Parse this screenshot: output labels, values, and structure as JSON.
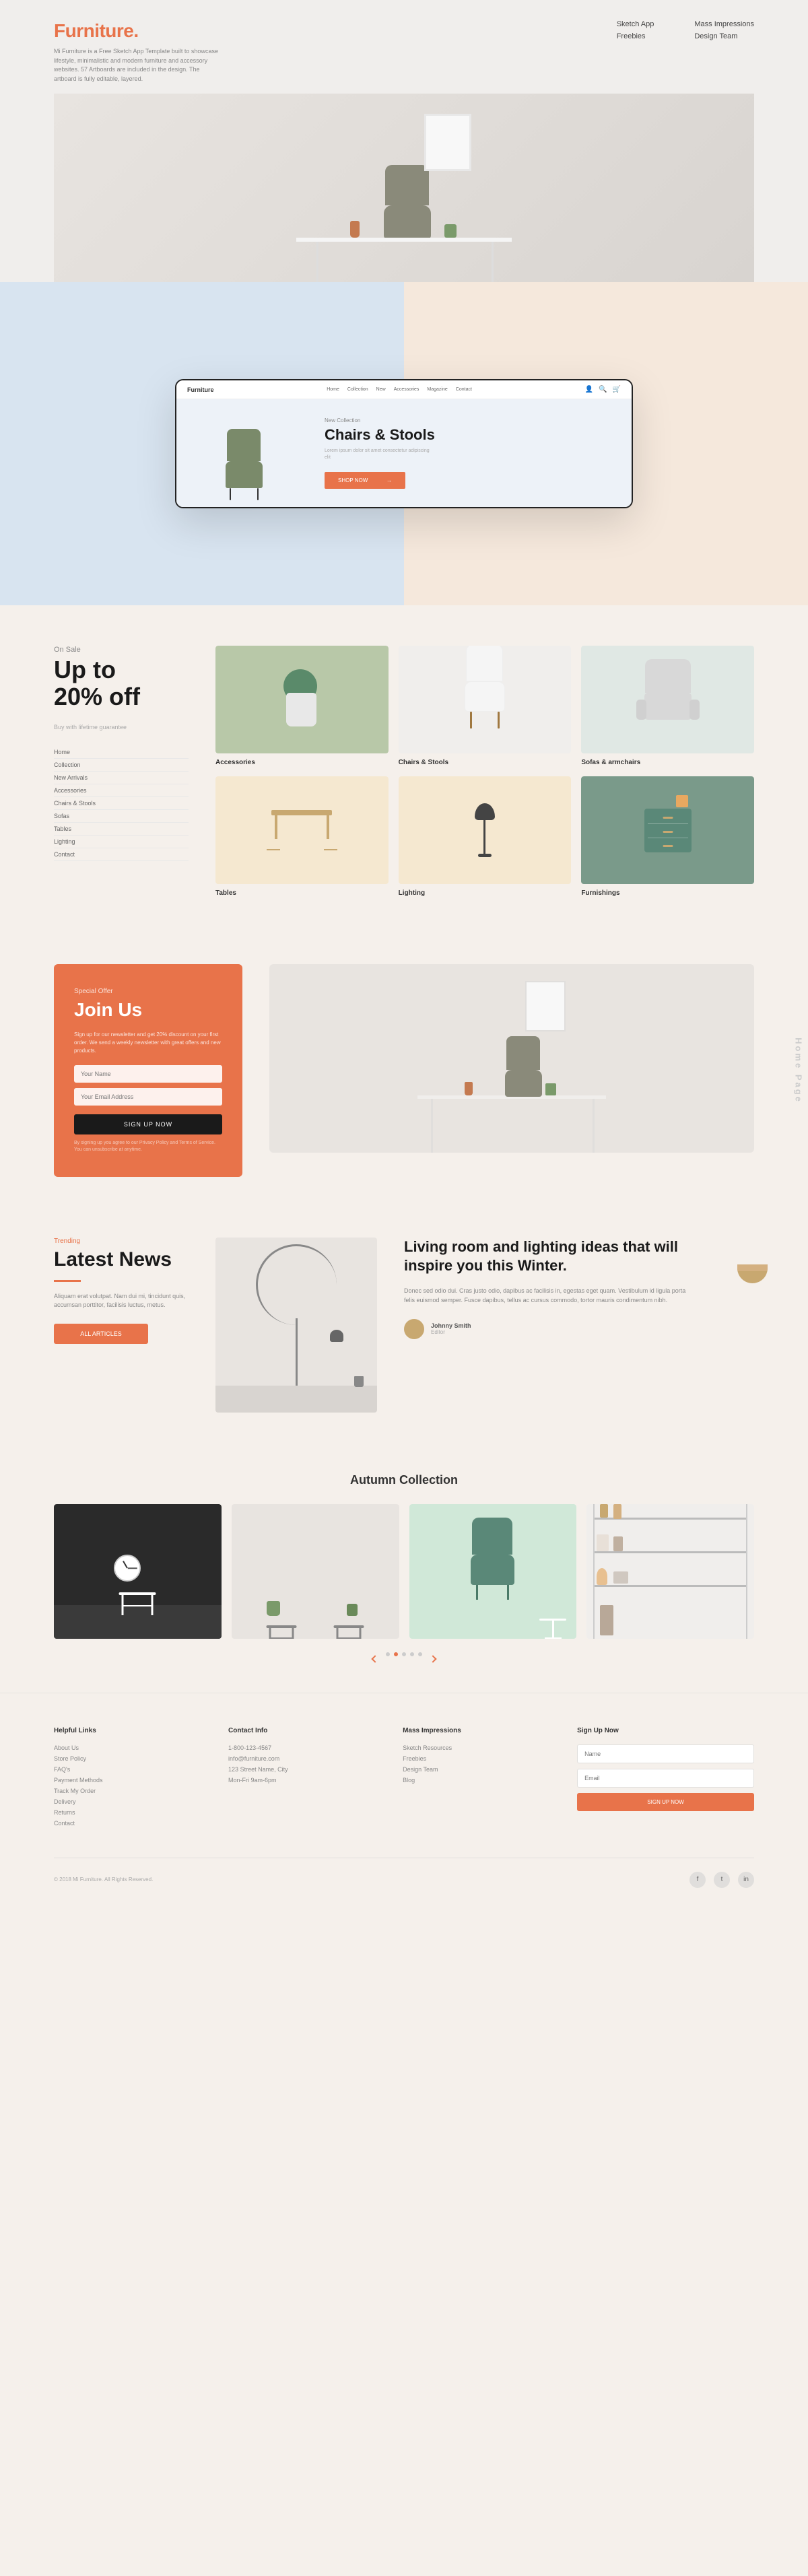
{
  "header": {
    "logo": "Furniture",
    "logo_dot": ".",
    "description": "Mi Furniture is a Free Sketch App Template built to showcase lifestyle, minimalistic and modern furniture and accessory websites. 57 Artboards are included in the design. The artboard is fully editable, layered.",
    "nav": {
      "col1": [
        "Sketch App",
        "Freebies"
      ],
      "col2": [
        "Mass Impressions",
        "Design Team"
      ]
    }
  },
  "mockup": {
    "logo": "Furniture",
    "nav_items": [
      "Home",
      "Collection",
      "New",
      "Accessories",
      "Magazine",
      "Contact"
    ],
    "collection_label": "New Collection",
    "hero_title": "Chairs & Stools",
    "hero_desc": "Lorem ipsum dolor sit amet consectetur adipiscing elit",
    "btn_label": "SHOP NOW"
  },
  "sale": {
    "on_sale": "On Sale",
    "title": "Up to\n20% off",
    "desc": "Buy with lifetime guarantee",
    "categories": [
      "Home",
      "Collection",
      "New Arrivals",
      "Accessories",
      "Chairs & Stools",
      "Sofas",
      "Tables",
      "Lighting",
      "Contact"
    ],
    "grid_categories": [
      {
        "label": "Accessories",
        "color": "accessories"
      },
      {
        "label": "Chairs & Stools",
        "color": "chairs"
      },
      {
        "label": "Sofas & armchairs",
        "color": "sofas"
      },
      {
        "label": "Tables",
        "color": "tables"
      },
      {
        "label": "Lighting",
        "color": "lighting"
      },
      {
        "label": "Furnishings",
        "color": "furnishings"
      }
    ]
  },
  "join": {
    "special": "Special Offer",
    "title": "Join Us",
    "desc": "Sign up for our newsletter and get 20% discount on your first order. We send a weekly newsletter with great offers and new products.",
    "name_placeholder": "Your Name",
    "email_placeholder": "Your Email Address",
    "btn": "SIGN UP NOW",
    "privacy": "By signing up you agree to our Privacy Policy and Terms of Service. You can unsubscribe at anytime.",
    "homepage_label": "Home Page"
  },
  "news": {
    "trending": "Trending",
    "title": "Latest News",
    "desc": "Aliquam erat volutpat. Nam dui mi, tincidunt quis, accumsan porttitor, facilisis luctus, metus.",
    "btn": "ALL ARTICLES",
    "article_title": "Living room and lighting ideas that will inspire you this Winter.",
    "article_desc": "Donec sed odio dui. Cras justo odio, dapibus ac facilisis in, egestas eget quam. Vestibulum id ligula porta felis euismod semper. Fusce dapibus, tellus ac cursus commodo, tortor mauris condimentum nibh.",
    "author_name": "Johnny Smith",
    "author_role": "Editor"
  },
  "autumn": {
    "label": "Autumn Collection",
    "dots": [
      false,
      true,
      false,
      false,
      false
    ]
  },
  "footer": {
    "col1_title": "Helpful Links",
    "col1_links": [
      "About Us",
      "Store Policy",
      "FAQ's",
      "Payment Methods",
      "Track My Order",
      "Delivery",
      "Returns",
      "Contact"
    ],
    "col2_title": "Contact Info",
    "col2_items": [
      "1-800-123-4567",
      "info@furniture.com",
      "123 Street Name, City",
      "Mon-Fri 9am-6pm"
    ],
    "col3_title": "Mass Impressions",
    "col3_links": [
      "Sketch Resources",
      "Freebies",
      "Design Team",
      "Blog"
    ],
    "col4_title": "Sign Up Now",
    "col4_email_placeholder": "Email",
    "col4_name_placeholder": "Name",
    "col4_btn": "SIGN UP NOW",
    "copy": "© 2018 Mi Furniture. All Rights Reserved.",
    "social": [
      "f",
      "t",
      "in"
    ]
  }
}
